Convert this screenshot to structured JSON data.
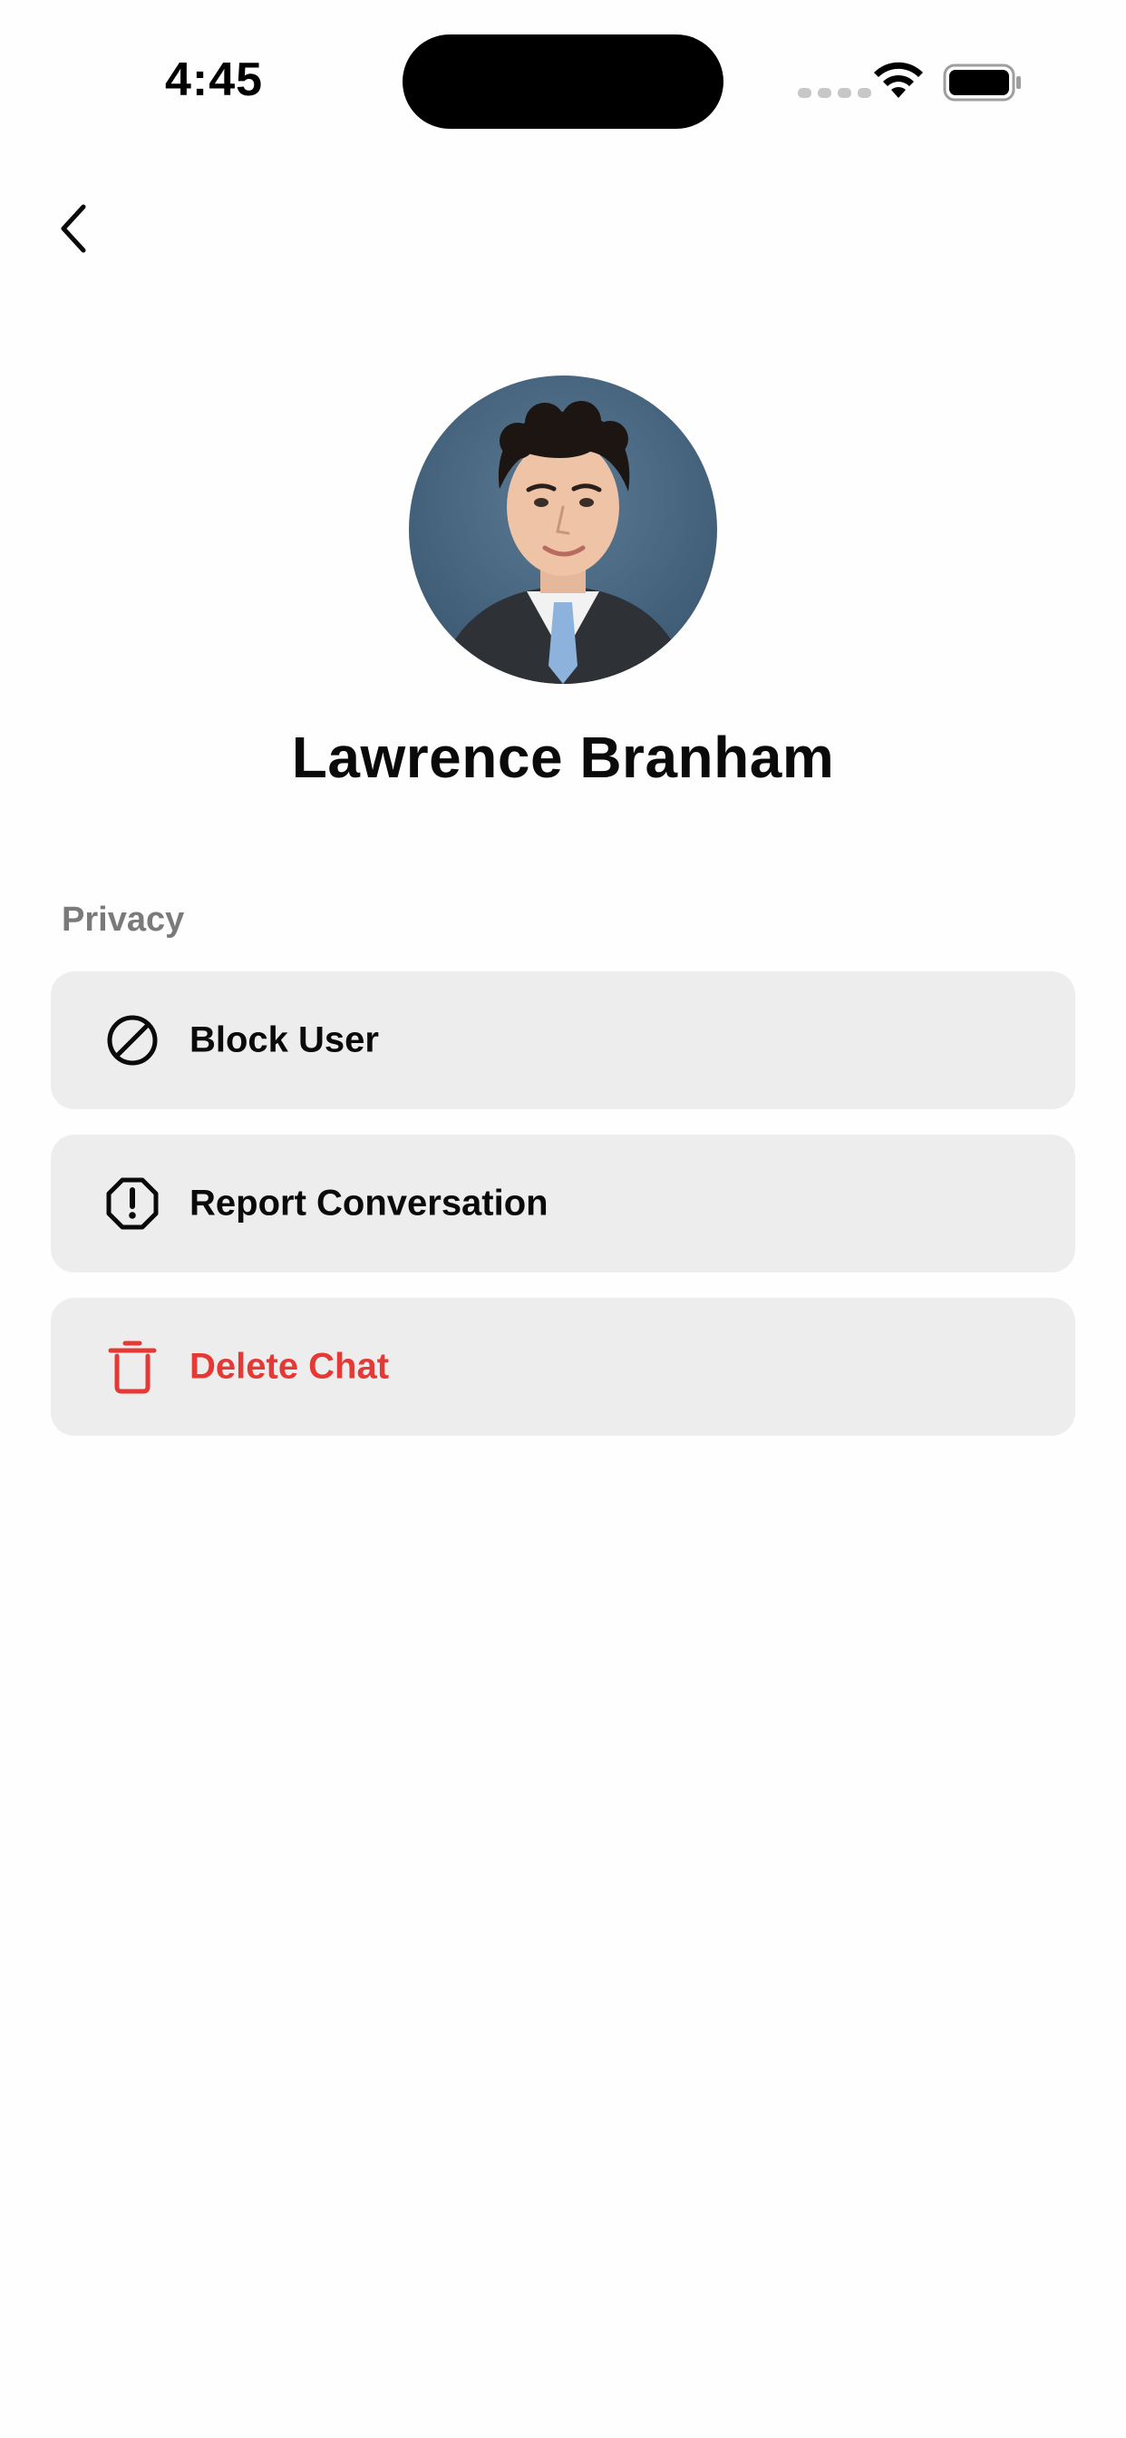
{
  "status_bar": {
    "time": "4:45"
  },
  "header": {
    "back_icon": "chevron-left-icon"
  },
  "profile": {
    "name": "Lawrence Branham",
    "avatar_icon": "avatar-photo"
  },
  "privacy": {
    "section_label": "Privacy",
    "items": [
      {
        "label": "Block User",
        "icon": "block-icon"
      },
      {
        "label": "Report Conversation",
        "icon": "report-icon"
      },
      {
        "label": "Delete Chat",
        "icon": "trash-icon",
        "color": "#e53935"
      }
    ]
  },
  "colors": {
    "row_background": "#ededed",
    "danger": "#e53935",
    "section_label": "#7a7a7a"
  }
}
